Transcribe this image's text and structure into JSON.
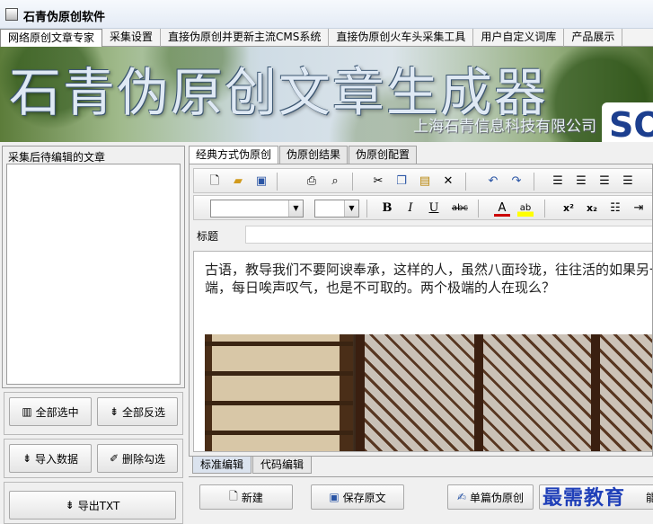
{
  "window": {
    "title": "石青伪原创软件"
  },
  "main_tabs": [
    {
      "label": "网络原创文章专家",
      "active": true
    },
    {
      "label": "采集设置"
    },
    {
      "label": "直接伪原创并更新主流CMS系统"
    },
    {
      "label": "直接伪原创火车头采集工具"
    },
    {
      "label": "用户自定义词库"
    },
    {
      "label": "产品展示"
    }
  ],
  "banner": {
    "headline": "石青伪原创文章生成器",
    "company": "上海石青信息科技有限公司",
    "logo_text": "SO"
  },
  "left_panel": {
    "caption": "采集后待编辑的文章",
    "buttons": {
      "select_all": "全部选中",
      "invert_select": "全部反选",
      "import_data": "导入数据",
      "delete_checked": "删除勾选",
      "export_txt": "导出TXT"
    }
  },
  "right_tabs": [
    {
      "label": "经典方式伪原创",
      "active": true
    },
    {
      "label": "伪原创结果"
    },
    {
      "label": "伪原创配置"
    }
  ],
  "editor": {
    "title_label": "标题",
    "title_value": "",
    "font_name": "",
    "font_size": "",
    "body_text": "古语，教导我们不要阿谀奉承，这样的人，虽然八面玲珑，往往活的如果另一个极端，每日唉声叹气，也是不可取的。两个极端的人在现么？"
  },
  "toolbar_icons": {
    "row1": [
      "new-doc-icon",
      "open-folder-icon",
      "save-icon",
      "print-icon",
      "print-preview-icon",
      "cut-icon",
      "copy-icon",
      "paste-icon",
      "delete-icon",
      "undo-icon",
      "redo-icon",
      "align-left-icon",
      "align-center-icon",
      "align-right-icon",
      "align-justify-icon"
    ],
    "row2": [
      "bold-icon",
      "italic-icon",
      "underline-icon",
      "strikethrough-icon",
      "font-color-icon",
      "highlight-icon",
      "superscript-icon",
      "subscript-icon",
      "numbered-list-icon",
      "indent-icon"
    ]
  },
  "bottom_tabs": [
    {
      "label": "标准编辑",
      "active": true
    },
    {
      "label": "代码编辑"
    }
  ],
  "bottom_buttons": {
    "new": "新建",
    "save_original": "保存原文",
    "single_rewrite": "单篇伪原创",
    "partial": "能"
  },
  "watermark": "最需教育"
}
